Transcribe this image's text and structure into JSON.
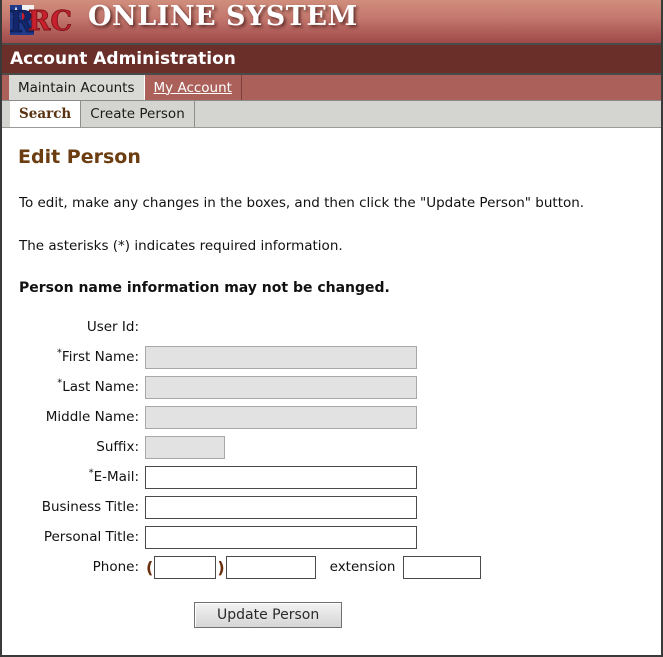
{
  "banner": {
    "logo_alt": "rrc-texas-logo",
    "title_first_letter": "O",
    "title_word_one_rest": "NLINE",
    "title_second_letter": "S",
    "title_word_two_rest": "YSTEM",
    "title_full": "ONLINE SYSTEM"
  },
  "section": {
    "label": "Account Administration"
  },
  "primary_tabs": [
    {
      "label": "Maintain Acounts",
      "state": "active"
    },
    {
      "label": "My Account ",
      "state": "link"
    }
  ],
  "secondary_tabs": [
    {
      "label": "Search",
      "state": "active"
    },
    {
      "label": "Create Person",
      "state": "inactive"
    }
  ],
  "main": {
    "heading": "Edit Person",
    "instruction": "To edit, make any changes in the boxes, and then click the \"Update Person\" button.",
    "asterisk_note": "The asterisks (*) indicates required information.",
    "name_notice": "Person name information may not be changed."
  },
  "form": {
    "rows": [
      {
        "label": "User Id:",
        "required": false,
        "field": "none",
        "value": "",
        "state": "none"
      },
      {
        "label": "First Name:",
        "required": true,
        "field": "long",
        "value": "",
        "state": "disabled"
      },
      {
        "label": "Last Name:",
        "required": true,
        "field": "long",
        "value": "",
        "state": "disabled"
      },
      {
        "label": "Middle Name:",
        "required": false,
        "field": "long",
        "value": "",
        "state": "disabled"
      },
      {
        "label": "Suffix:",
        "required": false,
        "field": "suffix",
        "value": "",
        "state": "disabled"
      },
      {
        "label": "E-Mail:",
        "required": true,
        "field": "long",
        "value": "",
        "state": "editable"
      },
      {
        "label": "Business Title:",
        "required": false,
        "field": "long",
        "value": "",
        "state": "editable"
      },
      {
        "label": "Personal Title:",
        "required": false,
        "field": "long",
        "value": "",
        "state": "editable"
      },
      {
        "label": "Phone:",
        "required": false,
        "field": "phone",
        "value": "",
        "state": "editable"
      }
    ],
    "phone": {
      "open_paren": "(",
      "close_paren": ")",
      "area_value": "",
      "number_value": "",
      "extension_label": "extension",
      "extension_value": ""
    },
    "required_marker": "*"
  },
  "actions": {
    "submit_label": "Update Person"
  },
  "colors": {
    "banner_top": "#d08e7c",
    "banner_bottom": "#9e4a4a",
    "section_bar": "#6b2f2a",
    "primary_tab_bar": "#ab6059",
    "secondary_tab_bar": "#d4d4d1",
    "heading_brown": "#6b3d10",
    "active_tab_text": "#5a3310",
    "disabled_field": "#e2e2e2",
    "page_border": "#3a3a3a"
  }
}
